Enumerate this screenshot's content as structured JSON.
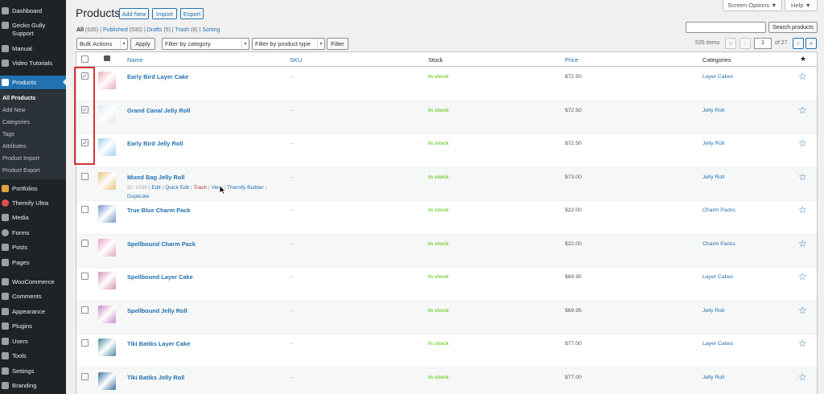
{
  "sidebar": {
    "items": [
      {
        "label": "Dashboard",
        "icon": "dashboard-icon"
      },
      {
        "label": "Gecko Gully Support",
        "icon": "gecko-icon"
      },
      {
        "label": "Manual",
        "icon": "manual-icon"
      },
      {
        "label": "Video Tutorials",
        "icon": "video-icon"
      },
      {
        "label": "Products",
        "icon": "products-icon"
      },
      {
        "label": "Portfolios",
        "icon": "portfolio-icon"
      },
      {
        "label": "Themify Ultra",
        "icon": "themify-icon"
      },
      {
        "label": "Media",
        "icon": "media-icon"
      },
      {
        "label": "Forms",
        "icon": "forms-icon"
      },
      {
        "label": "Posts",
        "icon": "pin-icon"
      },
      {
        "label": "Pages",
        "icon": "pages-icon"
      },
      {
        "label": "WooCommerce",
        "icon": "woocommerce-icon"
      },
      {
        "label": "Comments",
        "icon": "comments-icon"
      },
      {
        "label": "Appearance",
        "icon": "brush-icon"
      },
      {
        "label": "Plugins",
        "icon": "plugin-icon"
      },
      {
        "label": "Users",
        "icon": "users-icon"
      },
      {
        "label": "Tools",
        "icon": "wrench-icon"
      },
      {
        "label": "Settings",
        "icon": "settings-icon"
      },
      {
        "label": "Branding",
        "icon": "branding-icon"
      }
    ],
    "submenu": [
      "All Products",
      "Add New",
      "Categories",
      "Tags",
      "Attributes",
      "Product Import",
      "Product Export"
    ]
  },
  "top": {
    "screen_options": "Screen Options ▼",
    "help": "Help ▼"
  },
  "header": {
    "title": "Products",
    "add_new": "Add New",
    "import": "Import",
    "export": "Export"
  },
  "filters": {
    "all": "All",
    "all_count": "(535)",
    "published": "Published",
    "published_count": "(530)",
    "drafts": "Drafts",
    "drafts_count": "(5)",
    "trash": "Trash",
    "trash_count": "(6)",
    "sorting": "Sorting"
  },
  "search": {
    "button": "Search products",
    "value": ""
  },
  "toolbar": {
    "bulk_actions": "Bulk Actions",
    "apply": "Apply",
    "category": "Filter by category",
    "product_type": "Filter by product type",
    "filter": "Filter"
  },
  "pagination": {
    "items": "535 items",
    "first": "«",
    "prev": "‹",
    "current": "1",
    "total": "of 27",
    "next": "›",
    "last": "»"
  },
  "columns": {
    "name": "Name",
    "sku": "SKU",
    "stock": "Stock",
    "price": "Price",
    "categories": "Categories",
    "featured": "★"
  },
  "products": [
    {
      "name": "Early Bird Layer Cake",
      "sku": "–",
      "stock": "In stock",
      "price": "$72.50",
      "category": "Layer Cakes",
      "checked": true,
      "thumb": "#f2a7b8"
    },
    {
      "name": "Grand Canal Jelly Roll",
      "sku": "–",
      "stock": "In stock",
      "price": "$72.50",
      "category": "Jelly Roll",
      "checked": true,
      "thumb": "#dfe6ee"
    },
    {
      "name": "Early Bird Jelly Roll",
      "sku": "–",
      "stock": "In stock",
      "price": "$72.50",
      "category": "Jelly Roll",
      "checked": true,
      "thumb": "#9fd0e8"
    },
    {
      "name": "Mixed Bag Jelly Roll",
      "sku": "–",
      "stock": "In stock",
      "price": "$73.00",
      "category": "Jelly Roll",
      "checked": false,
      "thumb": "#e8c07a"
    },
    {
      "name": "True Blue Charm Pack",
      "sku": "–",
      "stock": "In stock",
      "price": "$22.00",
      "category": "Charm Packs",
      "checked": false,
      "thumb": "#6f95c8"
    },
    {
      "name": "Spellbound Charm Pack",
      "sku": "–",
      "stock": "In stock",
      "price": "$22.00",
      "category": "Charm Packs",
      "checked": false,
      "thumb": "#e7a3c4"
    },
    {
      "name": "Spellbound Layer Cake",
      "sku": "–",
      "stock": "In stock",
      "price": "$69.95",
      "category": "Layer Cakes",
      "checked": false,
      "thumb": "#d98fb3"
    },
    {
      "name": "Spellbound Jelly Roll",
      "sku": "–",
      "stock": "In stock",
      "price": "$69.95",
      "category": "Jelly Roll",
      "checked": false,
      "thumb": "#c78ac8"
    },
    {
      "name": "Tiki Batiks Layer Cake",
      "sku": "–",
      "stock": "In stock",
      "price": "$77.00",
      "category": "Layer Cakes",
      "checked": false,
      "thumb": "#4a8a9a"
    },
    {
      "name": "Tiki Batiks Jelly Roll",
      "sku": "–",
      "stock": "In stock",
      "price": "$77.00",
      "category": "Jelly Roll",
      "checked": false,
      "thumb": "#3d6fa0"
    }
  ],
  "row_actions": {
    "id": "ID: 1599",
    "edit": "Edit",
    "quick_edit": "Quick Edit",
    "trash": "Trash",
    "view": "View",
    "themify": "Themify Builder",
    "duplicate": "Duplicate"
  },
  "colors": {
    "accent": "#2271b1",
    "sidebar": "#1d2327",
    "in_stock": "#7ad03a",
    "highlight": "#d63638"
  }
}
